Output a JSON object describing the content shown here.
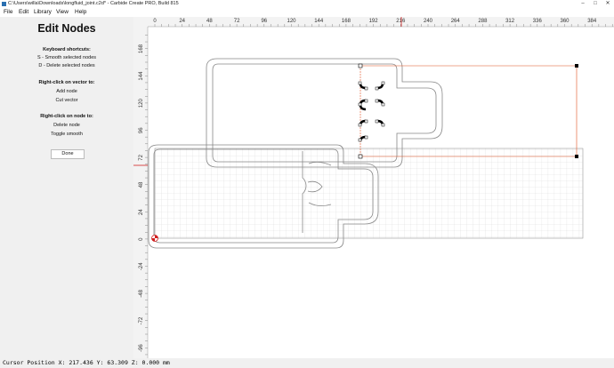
{
  "window": {
    "title": "C:\\Users\\willa\\Downloads\\longfluid_joint.c2d* - Carbide Create PRO, Build 815",
    "buttons": [
      "–",
      "□",
      "✕"
    ],
    "icon": "app-icon"
  },
  "menu": [
    "File",
    "Edit",
    "Library",
    "View",
    "Help"
  ],
  "panel": {
    "title": "Edit Nodes",
    "sections": [
      {
        "heading": "Keyboard shortcuts:",
        "items": [
          "S - Smooth selected nodes",
          "D - Delete selected nodes"
        ]
      },
      {
        "heading": "Right-click on vector to:",
        "items": [
          "Add node",
          "Cut vector"
        ]
      },
      {
        "heading": "Right-click on node to:",
        "items": [
          "Delete node",
          "Toggle smooth"
        ]
      }
    ],
    "done_label": "Done"
  },
  "ruler": {
    "x_ticks": [
      "0",
      "24",
      "48",
      "72",
      "96",
      "120",
      "144",
      "168",
      "192",
      "216",
      "240",
      "264",
      "288",
      "312",
      "336",
      "360",
      "384"
    ],
    "y_ticks": [
      "168",
      "144",
      "120",
      "96",
      "72",
      "48",
      "24",
      "0",
      "-24",
      "-48",
      "-72",
      "-96"
    ]
  },
  "status": {
    "cursor_text": "Cursor Position X: 217.436 Y: 63.309 Z: 0.000 mm"
  },
  "colors": {
    "selection": "#e05020",
    "origin": "#d02020",
    "grid": "#d8d8d8",
    "outline": "#888888"
  }
}
